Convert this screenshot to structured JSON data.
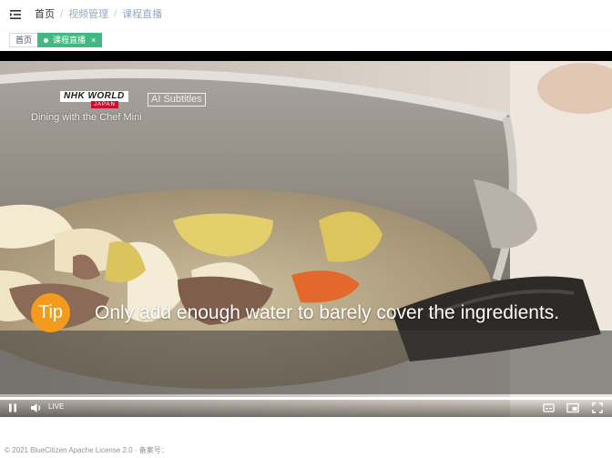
{
  "breadcrumb": {
    "home": "首页",
    "separator": "/",
    "level1": "视频管理",
    "level2": "课程直播"
  },
  "tags": {
    "home": "首页",
    "active": "课程直播",
    "close_glyph": "×"
  },
  "video": {
    "channel": "NHK WORLD",
    "channel_sub": "JAPAN",
    "show_title": "Dining with the Chef Mini",
    "ai_badge": "AI Subtitles",
    "tip_label": "Tip",
    "subtitle": "Only add enough water to barely cover the ingredients.",
    "live_label": "LIVE",
    "progress_fraction": 1.0
  },
  "icons": {
    "menu": "hamburger-icon",
    "pause": "pause-icon",
    "volume": "volume-icon",
    "captions": "captions-icon",
    "pip": "picture-in-picture-icon",
    "fullscreen": "fullscreen-icon"
  },
  "colors": {
    "accent": "#42b983",
    "tip": "#f29b1f"
  },
  "footer": {
    "text": "© 2021 BlueCitizen Apache License 2.0 · 备案号："
  }
}
